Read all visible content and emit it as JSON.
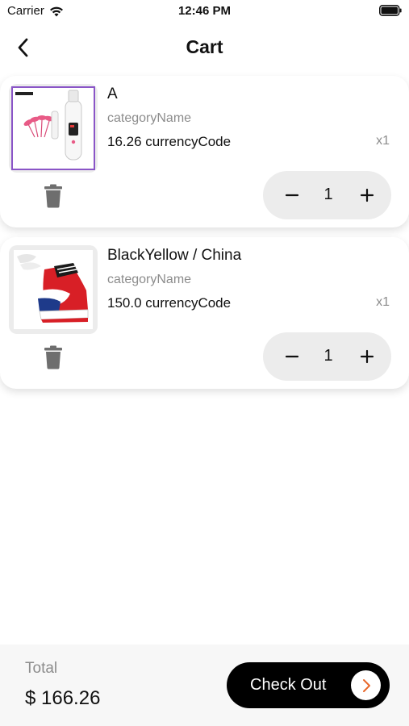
{
  "status_bar": {
    "carrier": "Carrier",
    "time": "12:46 PM"
  },
  "header": {
    "title": "Cart",
    "back_icon": "chevron-left-icon"
  },
  "cart": {
    "items": [
      {
        "name": "A",
        "category": "categoryName",
        "price": "16.26 currencyCode",
        "qty_label": "x1",
        "quantity": "1",
        "image": "beauty-device-product"
      },
      {
        "name": "BlackYellow / China",
        "category": "categoryName",
        "price": "150.0 currencyCode",
        "qty_label": "x1",
        "quantity": "1",
        "image": "sneaker-product"
      }
    ]
  },
  "footer": {
    "total_label": "Total",
    "total_value": "$ 166.26",
    "checkout_label": "Check Out",
    "checkout_icon": "chevron-right-icon"
  },
  "colors": {
    "accent": "#e8672a",
    "card_background": "#ffffff",
    "stepper_background": "#ececec",
    "button_background": "#000000",
    "muted_text": "#8c8c8c"
  }
}
